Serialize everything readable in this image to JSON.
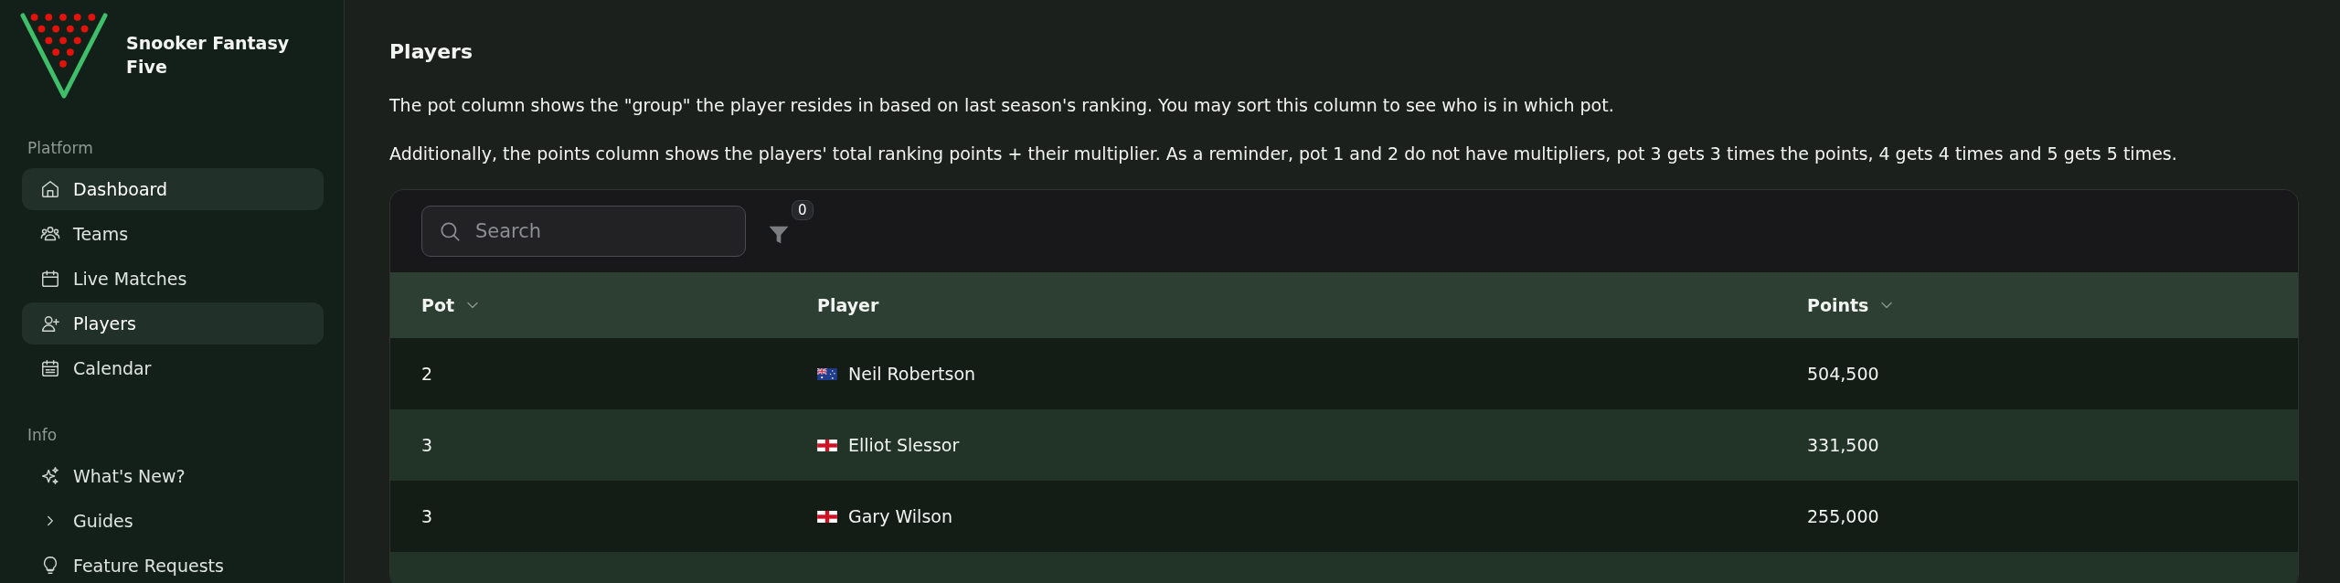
{
  "brand": {
    "name": "Snooker Fantasy Five"
  },
  "sidebar": {
    "sections": [
      {
        "label": "Platform",
        "items": [
          {
            "label": "Dashboard",
            "selected": true
          },
          {
            "label": "Teams",
            "selected": false
          },
          {
            "label": "Live Matches",
            "selected": false
          },
          {
            "label": "Players",
            "selected": true
          },
          {
            "label": "Calendar",
            "selected": false
          }
        ]
      },
      {
        "label": "Info",
        "items": [
          {
            "label": "What's New?",
            "kind": "link",
            "selected": false
          },
          {
            "label": "Guides",
            "kind": "group",
            "expanded": false,
            "selected": false
          },
          {
            "label": "Feature Requests",
            "kind": "link",
            "selected": false
          }
        ]
      }
    ]
  },
  "page": {
    "title": "Players",
    "paragraphs": [
      "The pot column shows the \"group\" the player resides in based on last season's ranking. You may sort this column to see who is in which pot.",
      "Additionally, the points column shows the players' total ranking points + their multiplier. As a reminder, pot 1 and 2 do not have multipliers, pot 3 gets 3 times the points, 4 gets 4 times and 5 gets 5 times."
    ]
  },
  "table": {
    "search": {
      "placeholder": "Search"
    },
    "filter_count": "0",
    "columns": [
      {
        "label": "Pot",
        "sortable": true
      },
      {
        "label": "Player",
        "sortable": false
      },
      {
        "label": "Points",
        "sortable": true
      }
    ],
    "rows": [
      {
        "pot": "2",
        "player": "Neil Robertson",
        "points": "504,500"
      },
      {
        "pot": "3",
        "player": "Elliot Slessor",
        "points": "331,500"
      },
      {
        "pot": "3",
        "player": "Gary Wilson",
        "points": "255,000"
      }
    ]
  }
}
